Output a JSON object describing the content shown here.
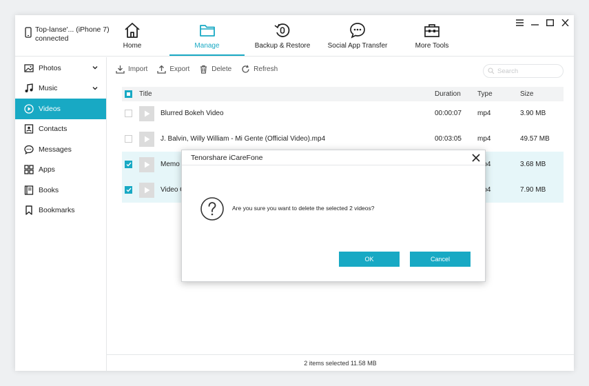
{
  "device": {
    "name": "Top-lanse'... (iPhone 7)",
    "status": "connected"
  },
  "nav": [
    {
      "label": "Home",
      "icon": "home-icon"
    },
    {
      "label": "Manage",
      "icon": "folder-icon",
      "active": true
    },
    {
      "label": "Backup & Restore",
      "icon": "backup-restore-icon"
    },
    {
      "label": "Social App Transfer",
      "icon": "chat-bubble-icon"
    },
    {
      "label": "More Tools",
      "icon": "toolbox-icon"
    }
  ],
  "sidebar": [
    {
      "label": "Photos",
      "icon": "photo-icon"
    },
    {
      "label": "Music",
      "icon": "music-note-icon"
    },
    {
      "label": "Videos",
      "icon": "play-circle-icon",
      "active": true
    },
    {
      "label": "Contacts",
      "icon": "contact-card-icon"
    },
    {
      "label": "Messages",
      "icon": "message-icon"
    },
    {
      "label": "Apps",
      "icon": "apps-grid-icon"
    },
    {
      "label": "Books",
      "icon": "book-icon"
    },
    {
      "label": "Bookmarks",
      "icon": "bookmark-icon"
    }
  ],
  "toolbar": {
    "import": "Import",
    "export": "Export",
    "delete": "Delete",
    "refresh": "Refresh"
  },
  "search": {
    "placeholder": "Search"
  },
  "table": {
    "columns": {
      "title": "Title",
      "duration": "Duration",
      "type": "Type",
      "size": "Size"
    },
    "rows": [
      {
        "title": "Blurred Bokeh Video",
        "duration": "00:00:07",
        "type": "mp4",
        "size": "3.90 MB",
        "checked": false
      },
      {
        "title": "J. Balvin, Willy William - Mi Gente (Official Video).mp4",
        "duration": "00:03:05",
        "type": "mp4",
        "size": "49.57 MB",
        "checked": false
      },
      {
        "title": "Memo",
        "duration": "",
        "type": "mp4",
        "size": "3.68 MB",
        "checked": true
      },
      {
        "title": "Video C",
        "duration": "",
        "type": "mp4",
        "size": "7.90 MB",
        "checked": true
      }
    ]
  },
  "status": "2 items selected 11.58 MB",
  "dialog": {
    "title": "Tenorshare iCareFone",
    "message": "Are you sure you want to delete the selected 2 videos?",
    "ok": "OK",
    "cancel": "Cancel"
  },
  "colors": {
    "accent": "#18a9c4",
    "selected_row": "#e6f6f9"
  }
}
